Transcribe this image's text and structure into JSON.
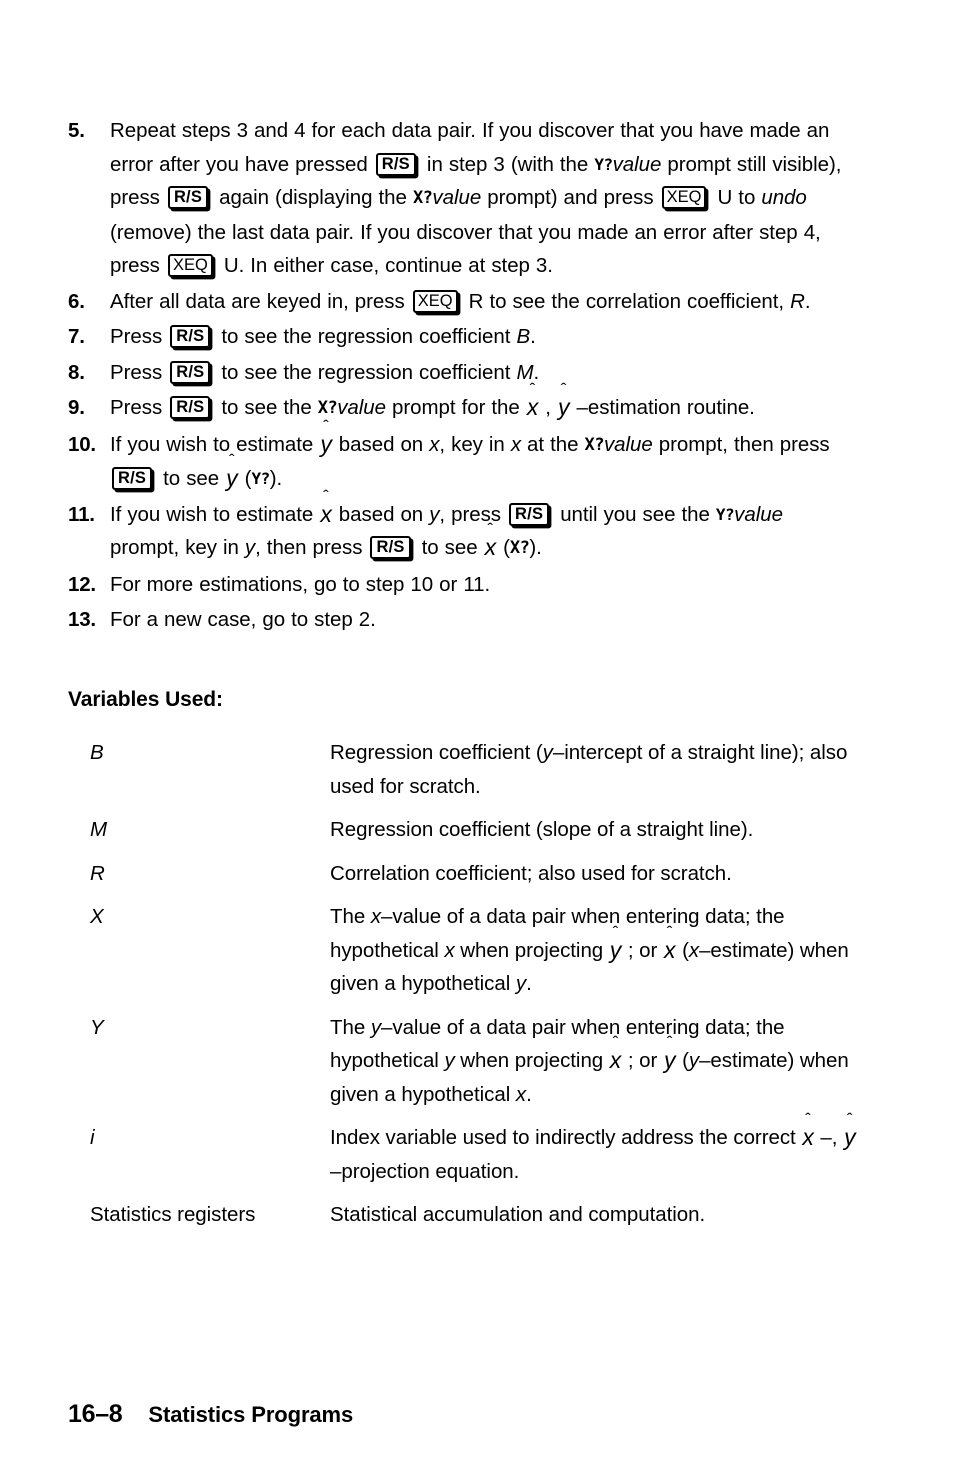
{
  "document": {
    "page_number": "16–8",
    "section_title": "Statistics Programs"
  },
  "steps": [
    {
      "number": "5.",
      "segments": [
        {
          "t": "text",
          "v": "Repeat steps 3 and 4 for each data pair. If you discover that you have made an error after you have pressed "
        },
        {
          "t": "key",
          "v": "R/S"
        },
        {
          "t": "text",
          "v": " in step 3 (with the "
        },
        {
          "t": "lcd",
          "v": "Y?"
        },
        {
          "t": "italic",
          "v": "value"
        },
        {
          "t": "text",
          "v": " prompt still visible), press "
        },
        {
          "t": "key",
          "v": "R/S"
        },
        {
          "t": "text",
          "v": " again (displaying the "
        },
        {
          "t": "lcd",
          "v": "X?"
        },
        {
          "t": "italic",
          "v": "value"
        },
        {
          "t": "text",
          "v": " prompt) and press "
        },
        {
          "t": "key",
          "v": "XEQ"
        },
        {
          "t": "text",
          "v": " U to "
        },
        {
          "t": "italic",
          "v": "undo"
        },
        {
          "t": "text",
          "v": " (remove) the last data pair. If you discover that you made an error after step 4, press "
        },
        {
          "t": "key",
          "v": "XEQ"
        },
        {
          "t": "text",
          "v": " U. In either case, continue at step 3."
        }
      ]
    },
    {
      "number": "6.",
      "segments": [
        {
          "t": "text",
          "v": "After all data are keyed in, press "
        },
        {
          "t": "key",
          "v": "XEQ"
        },
        {
          "t": "text",
          "v": " R to see the correlation coefficient, "
        },
        {
          "t": "italic",
          "v": "R"
        },
        {
          "t": "text",
          "v": "."
        }
      ]
    },
    {
      "number": "7.",
      "segments": [
        {
          "t": "text",
          "v": "Press "
        },
        {
          "t": "key",
          "v": "R/S"
        },
        {
          "t": "text",
          "v": " to see the regression coefficient "
        },
        {
          "t": "italic",
          "v": "B"
        },
        {
          "t": "text",
          "v": "."
        }
      ]
    },
    {
      "number": "8.",
      "segments": [
        {
          "t": "text",
          "v": "Press "
        },
        {
          "t": "key",
          "v": "R/S"
        },
        {
          "t": "text",
          "v": " to see the regression coefficient "
        },
        {
          "t": "italic",
          "v": "M"
        },
        {
          "t": "text",
          "v": "."
        }
      ]
    },
    {
      "number": "9.",
      "segments": [
        {
          "t": "text",
          "v": "Press "
        },
        {
          "t": "key",
          "v": "R/S"
        },
        {
          "t": "text",
          "v": " to see the "
        },
        {
          "t": "lcd",
          "v": "X?"
        },
        {
          "t": "italic",
          "v": "value"
        },
        {
          "t": "text",
          "v": " prompt for the  "
        },
        {
          "t": "hat",
          "v": "x"
        },
        {
          "t": "text",
          "v": " ,  "
        },
        {
          "t": "hat",
          "v": "y"
        },
        {
          "t": "text",
          "v": " –estimation routine."
        }
      ]
    },
    {
      "number": "10.",
      "segments": [
        {
          "t": "text",
          "v": "If you wish to estimate  "
        },
        {
          "t": "hat",
          "v": "y"
        },
        {
          "t": "text",
          "v": "  based on "
        },
        {
          "t": "italic",
          "v": "x"
        },
        {
          "t": "text",
          "v": ", key in "
        },
        {
          "t": "italic",
          "v": "x"
        },
        {
          "t": "text",
          "v": " at the "
        },
        {
          "t": "lcd",
          "v": "X?"
        },
        {
          "t": "italic",
          "v": "value"
        },
        {
          "t": "text",
          "v": " prompt, then press "
        },
        {
          "t": "key",
          "v": "R/S"
        },
        {
          "t": "text",
          "v": " to see  "
        },
        {
          "t": "hat",
          "v": "y"
        },
        {
          "t": "text",
          "v": "  ("
        },
        {
          "t": "lcd",
          "v": "Y?"
        },
        {
          "t": "text",
          "v": ")."
        }
      ]
    },
    {
      "number": "11.",
      "segments": [
        {
          "t": "text",
          "v": "If you wish to estimate  "
        },
        {
          "t": "hat",
          "v": "x"
        },
        {
          "t": "text",
          "v": "  based on "
        },
        {
          "t": "italic",
          "v": "y"
        },
        {
          "t": "text",
          "v": ", press "
        },
        {
          "t": "key",
          "v": "R/S"
        },
        {
          "t": "text",
          "v": " until you see the "
        },
        {
          "t": "lcd",
          "v": "Y?"
        },
        {
          "t": "italic",
          "v": "value"
        },
        {
          "t": "text",
          "v": " prompt, key in "
        },
        {
          "t": "italic",
          "v": "y"
        },
        {
          "t": "text",
          "v": ", then press "
        },
        {
          "t": "key",
          "v": "R/S"
        },
        {
          "t": "text",
          "v": " to see  "
        },
        {
          "t": "hat",
          "v": "x"
        },
        {
          "t": "text",
          "v": "  ("
        },
        {
          "t": "lcd",
          "v": "X?"
        },
        {
          "t": "text",
          "v": ")."
        }
      ]
    },
    {
      "number": "12.",
      "segments": [
        {
          "t": "text",
          "v": "For more estimations, go to step 10 or 11."
        }
      ]
    },
    {
      "number": "13.",
      "segments": [
        {
          "t": "text",
          "v": "For a new case, go to step 2."
        }
      ]
    }
  ],
  "variables_section": {
    "heading": "Variables Used:",
    "rows": [
      {
        "name": "B",
        "name_style": "italic",
        "desc": [
          {
            "t": "text",
            "v": "Regression coefficient ("
          },
          {
            "t": "italic",
            "v": "y"
          },
          {
            "t": "text",
            "v": "–intercept of a straight line); also used for scratch."
          }
        ]
      },
      {
        "name": "M",
        "name_style": "italic",
        "desc": [
          {
            "t": "text",
            "v": "Regression coefficient (slope of a straight line)."
          }
        ]
      },
      {
        "name": "R",
        "name_style": "italic",
        "desc": [
          {
            "t": "text",
            "v": "Correlation coefficient; also used for scratch."
          }
        ]
      },
      {
        "name": "X",
        "name_style": "italic",
        "desc": [
          {
            "t": "text",
            "v": "The "
          },
          {
            "t": "italic",
            "v": "x"
          },
          {
            "t": "text",
            "v": "–value of a data pair when entering data; the hypothetical "
          },
          {
            "t": "italic",
            "v": "x"
          },
          {
            "t": "text",
            "v": " when projecting  "
          },
          {
            "t": "hat",
            "v": "y"
          },
          {
            "t": "text",
            "v": " ; or  "
          },
          {
            "t": "hat",
            "v": "x"
          },
          {
            "t": "text",
            "v": "  ("
          },
          {
            "t": "italic",
            "v": "x"
          },
          {
            "t": "text",
            "v": "–estimate) when given a hypothetical "
          },
          {
            "t": "italic",
            "v": "y"
          },
          {
            "t": "text",
            "v": "."
          }
        ]
      },
      {
        "name": "Y",
        "name_style": "italic",
        "desc": [
          {
            "t": "text",
            "v": "The "
          },
          {
            "t": "italic",
            "v": "y"
          },
          {
            "t": "text",
            "v": "–value of a data pair when entering data; the hypothetical "
          },
          {
            "t": "italic",
            "v": "y"
          },
          {
            "t": "text",
            "v": " when projecting  "
          },
          {
            "t": "hat",
            "v": "x"
          },
          {
            "t": "text",
            "v": " ; or  "
          },
          {
            "t": "hat",
            "v": "y"
          },
          {
            "t": "text",
            "v": "  ("
          },
          {
            "t": "italic",
            "v": "y"
          },
          {
            "t": "text",
            "v": "–estimate) when given a hypothetical "
          },
          {
            "t": "italic",
            "v": "x"
          },
          {
            "t": "text",
            "v": "."
          }
        ]
      },
      {
        "name": "i",
        "name_style": "italic",
        "desc": [
          {
            "t": "text",
            "v": "Index variable used to indirectly address the correct "
          },
          {
            "t": "hat",
            "v": "x"
          },
          {
            "t": "text",
            "v": " –,  "
          },
          {
            "t": "hat",
            "v": "y"
          },
          {
            "t": "text",
            "v": " –projection equation."
          }
        ]
      },
      {
        "name": "Statistics registers",
        "name_style": "plain",
        "desc": [
          {
            "t": "text",
            "v": "Statistical accumulation and computation."
          }
        ]
      }
    ]
  }
}
